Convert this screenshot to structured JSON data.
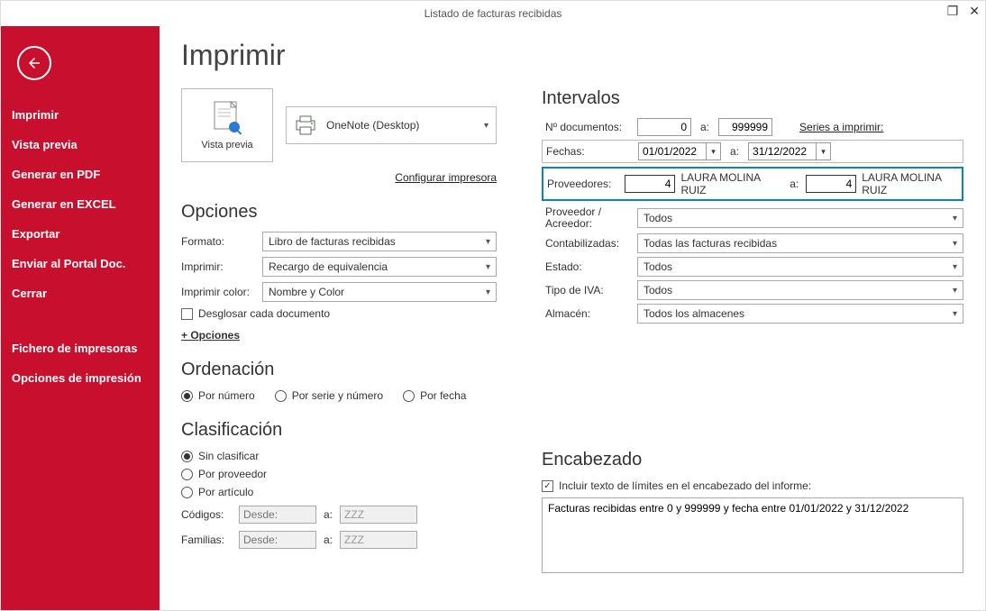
{
  "window": {
    "title": "Listado de facturas recibidas"
  },
  "page_title": "Imprimir",
  "sidebar": {
    "items": [
      "Imprimir",
      "Vista previa",
      "Generar en PDF",
      "Generar en EXCEL",
      "Exportar",
      "Enviar al Portal Doc.",
      "Cerrar"
    ],
    "items2": [
      "Fichero de impresoras",
      "Opciones de impresión"
    ]
  },
  "preview": {
    "label": "Vista previa"
  },
  "printer": {
    "name": "OneNote (Desktop)",
    "config_link": "Configurar impresora"
  },
  "opciones": {
    "title": "Opciones",
    "formato_lbl": "Formato:",
    "formato_val": "Libro de facturas recibidas",
    "imprimir_lbl": "Imprimir:",
    "imprimir_val": "Recargo de equivalencia",
    "color_lbl": "Imprimir color:",
    "color_val": "Nombre y Color",
    "desglosar": "Desglosar cada documento",
    "mas": "+ Opciones"
  },
  "orden": {
    "title": "Ordenación",
    "r1": "Por número",
    "r2": "Por serie y número",
    "r3": "Por fecha"
  },
  "clasif": {
    "title": "Clasificación",
    "r1": "Sin clasificar",
    "r2": "Por proveedor",
    "r3": "Por artículo",
    "codigos_lbl": "Códigos:",
    "familias_lbl": "Familias:",
    "desde_ph": "Desde:",
    "a_lbl": "a:",
    "zzz": "ZZZ"
  },
  "intervalos": {
    "title": "Intervalos",
    "ndoc_lbl": "Nº documentos:",
    "ndoc_from": "0",
    "a": "a:",
    "ndoc_to": "999999",
    "series_link": "Series a imprimir:",
    "fechas_lbl": "Fechas:",
    "fecha_from": "01/01/2022",
    "fecha_to": "31/12/2022",
    "prov_lbl": "Proveedores:",
    "prov_from_n": "4",
    "prov_from_name": "LAURA MOLINA RUIZ",
    "prov_to_n": "4",
    "prov_to_name": "LAURA MOLINA RUIZ",
    "provacre_lbl": "Proveedor / Acreedor:",
    "provacre_val": "Todos",
    "contab_lbl": "Contabilizadas:",
    "contab_val": "Todas las facturas recibidas",
    "estado_lbl": "Estado:",
    "estado_val": "Todos",
    "tipoiva_lbl": "Tipo de IVA:",
    "tipoiva_val": "Todos",
    "almacen_lbl": "Almacén:",
    "almacen_val": "Todos los almacenes"
  },
  "encabezado": {
    "title": "Encabezado",
    "chk": "Incluir texto de límites en el encabezado del informe:",
    "text": "Facturas recibidas entre 0 y 999999 y fecha entre 01/01/2022 y 31/12/2022"
  }
}
